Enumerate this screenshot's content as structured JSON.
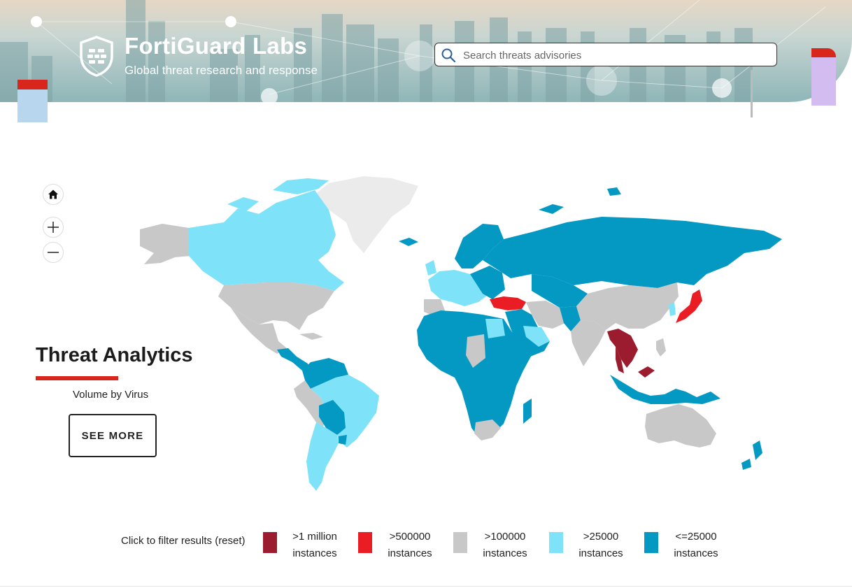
{
  "header": {
    "brand_title": "FortiGuard Labs",
    "brand_subtitle": "Global threat research and response",
    "search_placeholder": "Search threats advisories"
  },
  "icons": {
    "logo": "fortinet-shield-icon",
    "search": "magnifier-icon",
    "home": "home-icon",
    "zoom_in": "plus-icon",
    "zoom_out": "minus-icon"
  },
  "panel": {
    "title": "Threat Analytics",
    "subtitle": "Volume by Virus",
    "button_label": "SEE MORE"
  },
  "legend": {
    "label": "Click to filter results (reset)",
    "items": [
      {
        "line1": ">1 million",
        "line2": "instances",
        "color": "#9b1c2e"
      },
      {
        "line1": ">500000",
        "line2": "instances",
        "color": "#ea1c24"
      },
      {
        "line1": ">100000",
        "line2": "instances",
        "color": "#c8c8c8"
      },
      {
        "line1": ">25000",
        "line2": "instances",
        "color": "#7ee2f8"
      },
      {
        "line1": "<=25000",
        "line2": "instances",
        "color": "#0399c3"
      }
    ]
  },
  "map": {
    "no_data_color": "#ebebeb",
    "regions": [
      {
        "region": "Greenland",
        "level": "none"
      },
      {
        "region": "Alaska / USA",
        "level": ">100000"
      },
      {
        "region": "Canada",
        "level": ">25000"
      },
      {
        "region": "Mexico",
        "level": ">100000"
      },
      {
        "region": "Central America",
        "level": "<=25000"
      },
      {
        "region": "Colombia / Venezuela",
        "level": "<=25000"
      },
      {
        "region": "Brazil",
        "level": ">25000"
      },
      {
        "region": "Peru",
        "level": ">100000"
      },
      {
        "region": "Argentina / Chile",
        "level": ">25000"
      },
      {
        "region": "Bolivia / Paraguay",
        "level": "<=25000"
      },
      {
        "region": "Western Europe",
        "level": ">25000"
      },
      {
        "region": "Scandinavia",
        "level": "<=25000"
      },
      {
        "region": "Russia",
        "level": "<=25000"
      },
      {
        "region": "Turkey",
        "level": ">500000"
      },
      {
        "region": "Middle East",
        "level": "<=25000"
      },
      {
        "region": "Iran",
        "level": ">100000"
      },
      {
        "region": "Central Asia",
        "level": "<=25000"
      },
      {
        "region": "India",
        "level": ">100000"
      },
      {
        "region": "China",
        "level": ">100000"
      },
      {
        "region": "Japan",
        "level": ">500000"
      },
      {
        "region": "Mainland Southeast Asia",
        "level": ">1 million"
      },
      {
        "region": "Malaysia",
        "level": ">1 million"
      },
      {
        "region": "Indonesia / Philippines",
        "level": "<=25000"
      },
      {
        "region": "Africa",
        "level": "<=25000"
      },
      {
        "region": "South Africa",
        "level": ">100000"
      },
      {
        "region": "Australia",
        "level": ">100000"
      },
      {
        "region": "New Zealand",
        "level": "<=25000"
      }
    ]
  }
}
